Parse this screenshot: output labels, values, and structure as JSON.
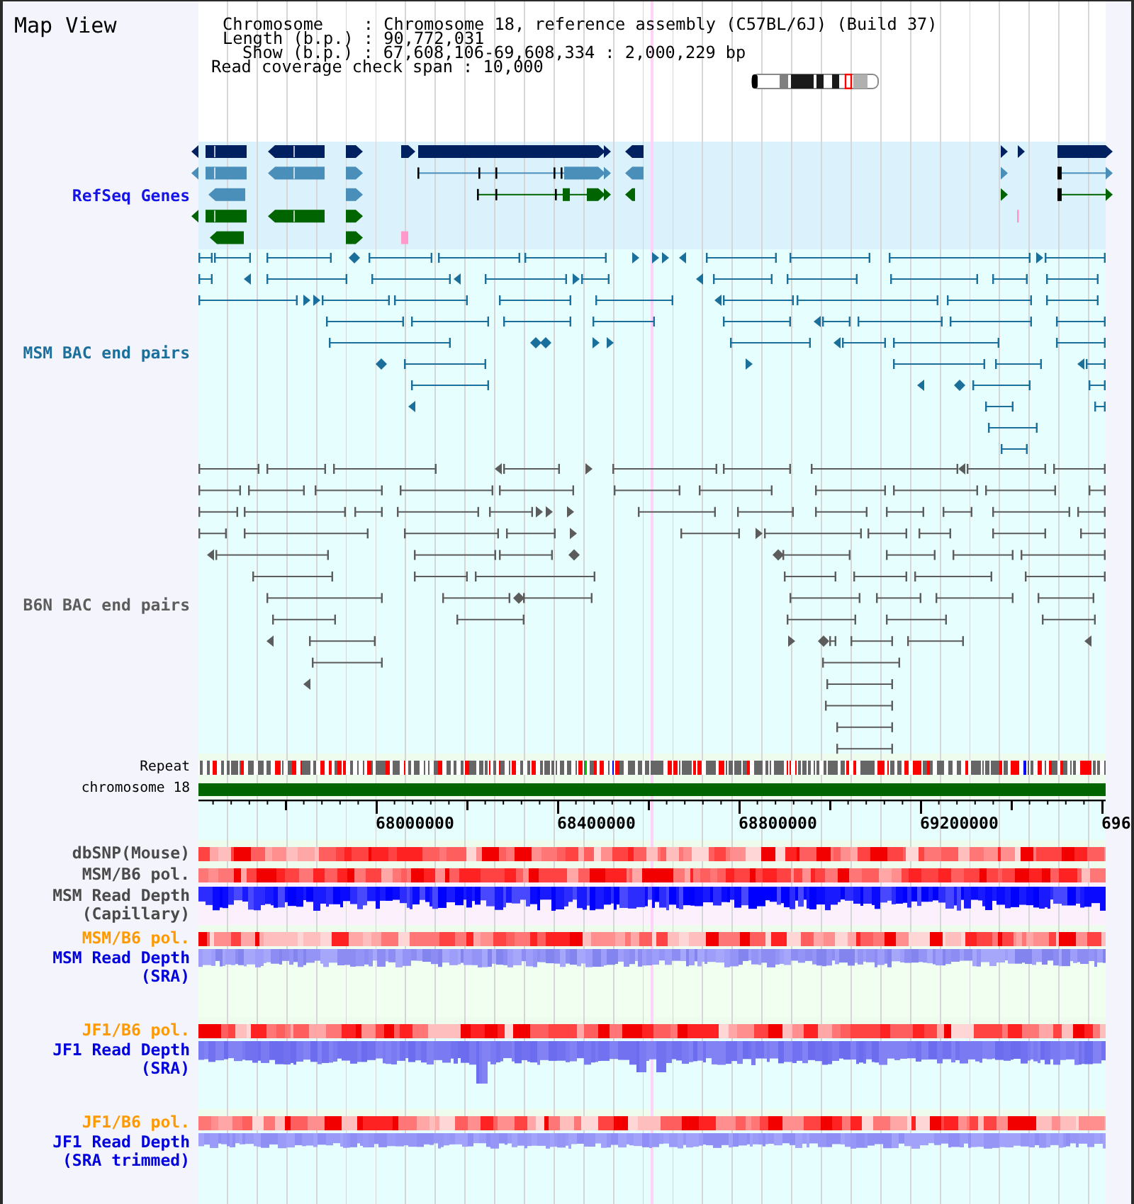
{
  "title": "Map View",
  "summary_lines": [
    "Chromosome    : Chromosome 18, reference assembly (C57BL/6J) (Build 37)",
    "Length (b.p.) : 90,772,031",
    "Show (b.p.) : 67,608,106-69,608,334 : 2,000,229 bp",
    "Read coverage check span : 10,000"
  ],
  "tracks": [
    {
      "kind": "genes",
      "label": "RefSeq Genes",
      "color": "#1414e8"
    },
    {
      "kind": "bac_pairs",
      "label": "MSM BAC end pairs",
      "color": "#1b6f9b"
    },
    {
      "kind": "bac_pairs",
      "label": "B6N BAC end pairs",
      "color": "#5c5c5c"
    },
    {
      "kind": "repeat",
      "label": "Repeat",
      "color": "#000000"
    },
    {
      "kind": "chromosome",
      "label": "chromosome 18",
      "color": "#000000"
    },
    {
      "kind": "axis",
      "tick_labels": [
        "68000000",
        "68400000",
        "68800000",
        "69200000",
        "696"
      ]
    },
    {
      "kind": "heatmap",
      "label": "dbSNP(Mouse)",
      "color": "#4a4a4a"
    },
    {
      "kind": "heatmap",
      "label": "MSM/B6 pol.",
      "color": "#4a4a4a"
    },
    {
      "kind": "depth",
      "label": "MSM Read Depth (Capillary)",
      "color": "#4a4a4a"
    },
    {
      "kind": "heatmap",
      "label": "MSM/B6 pol.",
      "color": "#ff9900"
    },
    {
      "kind": "depth",
      "label": "MSM Read Depth (SRA)",
      "color": "#0000dd"
    },
    {
      "kind": "heatmap",
      "label": "JF1/B6 pol.",
      "color": "#ff9900"
    },
    {
      "kind": "depth",
      "label": "JF1 Read Depth (SRA)",
      "color": "#0000dd"
    },
    {
      "kind": "heatmap",
      "label": "JF1/B6 pol.",
      "color": "#ff9900"
    },
    {
      "kind": "depth",
      "label": "JF1 Read Depth (SRA trimmed)",
      "color": "#0000dd"
    }
  ]
}
